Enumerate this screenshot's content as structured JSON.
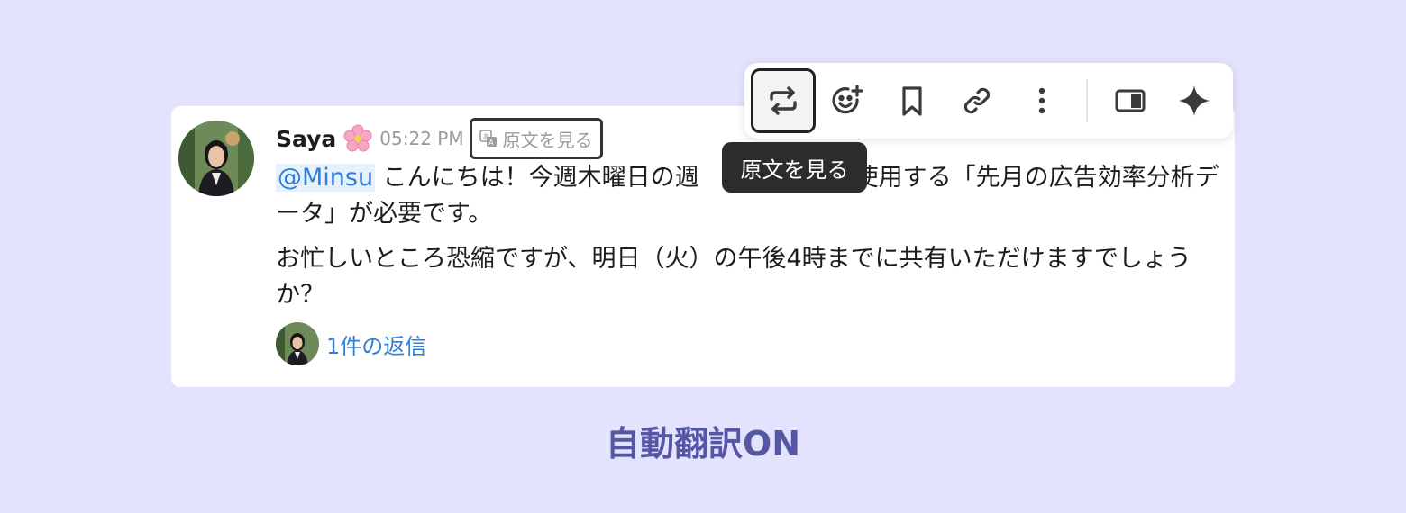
{
  "message": {
    "author": "Saya",
    "author_emoji_icon": "cherry-blossom-icon",
    "time": "05:22 PM",
    "view_original_label": "原文を見る",
    "mention": "@Minsu",
    "line1_text": " こんにちは！今週木曜日の週",
    "line1_tail": "料に使用する「先月の広告効率分析データ」が必要です。",
    "line2_text": "お忙しいところ恐縮ですが、明日（火）の午後4時までに共有いただけますでしょうか？",
    "thread_label": "1件の返信"
  },
  "toolbar": {
    "items": [
      {
        "name": "translate-toggle-button",
        "icon": "repeat-arrows-icon"
      },
      {
        "name": "add-reaction-button",
        "icon": "emoji-add-icon"
      },
      {
        "name": "bookmark-button",
        "icon": "bookmark-icon"
      },
      {
        "name": "copy-link-button",
        "icon": "link-icon"
      },
      {
        "name": "more-actions-button",
        "icon": "vertical-dots-icon"
      },
      {
        "name": "open-side-panel-button",
        "icon": "side-panel-icon"
      },
      {
        "name": "ai-sparkle-button",
        "icon": "sparkle-icon"
      }
    ],
    "tooltip": "原文を見る"
  },
  "caption": "自動翻訳ON",
  "colors": {
    "background": "#e3e3fd",
    "link": "#2f7fd6",
    "caption": "#5557a4",
    "tooltip_bg": "#2c2c2e"
  }
}
